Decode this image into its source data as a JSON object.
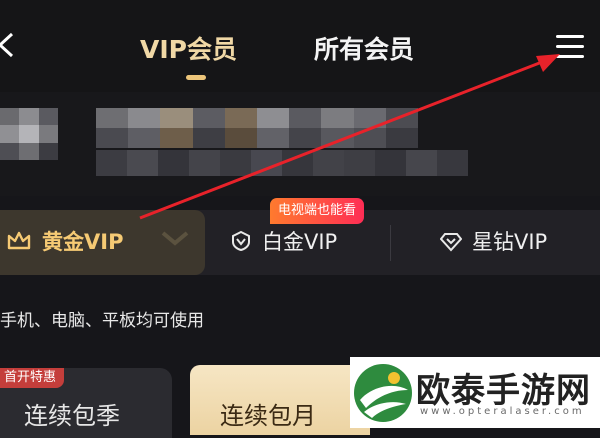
{
  "header": {
    "tabs": [
      {
        "label": "VIP会员"
      },
      {
        "label": "所有会员"
      }
    ]
  },
  "tiers": [
    {
      "label": "黄金VIP",
      "icon": "crown-icon"
    },
    {
      "label": "白金VIP",
      "icon": "shield-v-icon"
    },
    {
      "label": "星钻VIP",
      "icon": "diamond-v-icon"
    }
  ],
  "badge": {
    "text": "电视端也能看"
  },
  "devices_note": "手机、电脑、平板均可使用",
  "plans": [
    {
      "badge": "首开特惠",
      "label": "连续包季"
    },
    {
      "label": "连续包月"
    }
  ],
  "watermark": {
    "title": "欧泰手游网",
    "url": "www.opteralaser.com"
  },
  "colors": {
    "gold": "#f6ca74",
    "arrow": "#e8222a",
    "accent": "#ecc57a"
  }
}
